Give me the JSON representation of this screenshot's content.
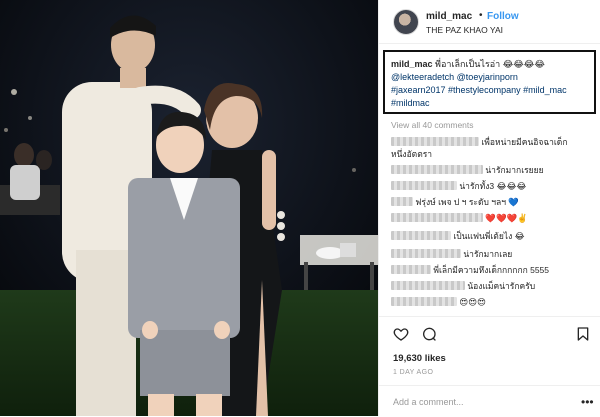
{
  "post": {
    "username": "mild_mac",
    "follow_label": "Follow",
    "separator": "•",
    "location": "THE PAZ KHAO YAI"
  },
  "caption": {
    "username": "mild_mac",
    "text": "พี่อาเล็กเป็นไรอ่า",
    "emojis_1": "😂😂😂😂",
    "mentions_1": "@lekteeradetch @toeyjarinporn",
    "tags_1": "#jaxearn2017 #thestylecompany #mild_mac",
    "tags_2": "#mildmac"
  },
  "view_all": "View all 40 comments",
  "comments": [
    {
      "text": "เพื่อหน่ายมีคนอิจฉาเด็ก",
      "text2": "หนึ่งอัตตรา"
    },
    {
      "text": "น่ารักมากเรยยย"
    },
    {
      "text": "น่ารักทั้ง3",
      "emoji": "😂😂😂"
    },
    {
      "text": "ฟรุ่งษ์ เพจ ป ฯ ระดับ ฯลฯ",
      "emoji": "💙"
    },
    {
      "text": "",
      "emoji": "❤️❤️❤️✌️"
    },
    {
      "text": "เป็นแฟนพี่เต้ยไง",
      "emoji": "😂"
    },
    {
      "text": "น่ารักมากเลย"
    },
    {
      "text": "พี่เล็กมีความหึงเด็กกกกกก 5555"
    },
    {
      "text": "น้องแม็คน่ารักครับ"
    },
    {
      "text": "",
      "emoji": "😍😍😍"
    }
  ],
  "likes": "19,630 likes",
  "time_ago": "1 DAY AGO",
  "add_comment_placeholder": "Add a comment...",
  "more_icon": "•••",
  "colors": {
    "link": "#003569",
    "follow": "#3897f0",
    "photo_bg": "#0b0f14"
  }
}
